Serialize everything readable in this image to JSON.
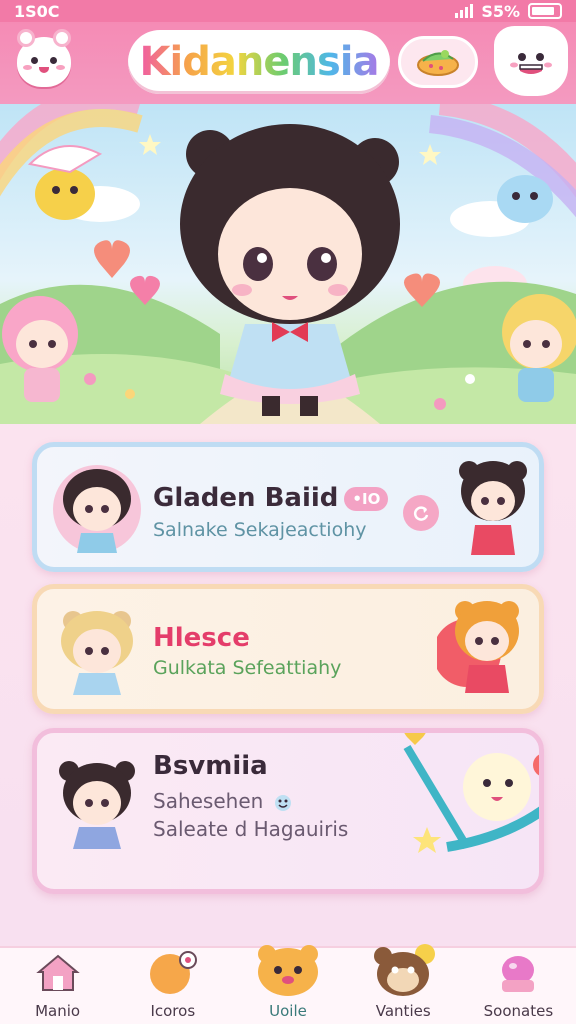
{
  "status_bar": {
    "time": "1S0C",
    "battery": "S5%"
  },
  "header": {
    "app_title": "Kidanensia"
  },
  "cards": [
    {
      "title": "Gladen Baiid",
      "badge": "•IO",
      "subtitle": "Salnake Sekajeactiohy"
    },
    {
      "title": "Hlesce",
      "subtitle": "Gulkata Sefeattiahy"
    },
    {
      "title": "Bsvmiia",
      "subtitle": "Sahesehen",
      "subtitle2": "Saleate d Hagauiris"
    }
  ],
  "bottom_nav": [
    {
      "label": "Manio"
    },
    {
      "label": "Icoros"
    },
    {
      "label": "Uoile"
    },
    {
      "label": "Vanties"
    },
    {
      "label": "Soonates"
    }
  ],
  "colors": {
    "header": "#f58bb5",
    "accent": "#f05ea3",
    "card1_border": "#bfdcf3",
    "card2_border": "#f8d9b5",
    "card3_border": "#f2bedc"
  },
  "icons": [
    "bear-mascot-icon",
    "snack-icon",
    "cloud-face-icon",
    "refresh-icon",
    "home-icon",
    "chat-bubble-icon",
    "bear-face-icon",
    "monkey-face-icon",
    "jar-icon"
  ]
}
